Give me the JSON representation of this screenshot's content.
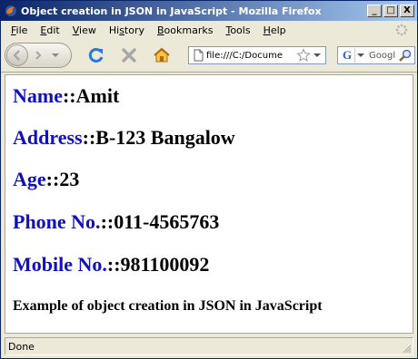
{
  "window": {
    "title": "Object creation in JSON in JavaScript - Mozilla Firefox",
    "controls": {
      "minimize": "_",
      "maximize": "□",
      "close": "X"
    }
  },
  "menu": {
    "items": [
      {
        "underline": "F",
        "rest": "ile"
      },
      {
        "underline": "E",
        "rest": "dit"
      },
      {
        "underline": "V",
        "rest": "iew"
      },
      {
        "underline": "",
        "rest": "Hi",
        "underline2": "s",
        "rest2": "tory"
      },
      {
        "underline": "B",
        "rest": "ookmarks"
      },
      {
        "underline": "T",
        "rest": "ools"
      },
      {
        "underline": "H",
        "rest": "elp"
      }
    ]
  },
  "toolbar": {
    "url": "file:///C:/Docume",
    "search_placeholder": "Googl",
    "icons": [
      "back-icon",
      "forward-icon",
      "dropdown-icon",
      "reload-icon",
      "stop-icon",
      "home-icon",
      "page-icon",
      "star-icon",
      "google-icon",
      "search-icon"
    ]
  },
  "content": {
    "records": [
      {
        "key": "Name",
        "sep": "::",
        "value": "Amit"
      },
      {
        "key": "Address",
        "sep": "::",
        "value": "B-123 Bangalow"
      },
      {
        "key": "Age",
        "sep": "::",
        "value": "23"
      },
      {
        "key": "Phone No.",
        "sep": "::",
        "value": "011-4565763"
      },
      {
        "key": "Mobile No.",
        "sep": "::",
        "value": "981100092"
      }
    ],
    "heading": "Example of object creation in JSON in JavaScript"
  },
  "status": {
    "text": "Done"
  },
  "colors": {
    "key": "#1010c0",
    "titlebar_start": "#0a246a",
    "titlebar_end": "#a6caf0"
  }
}
